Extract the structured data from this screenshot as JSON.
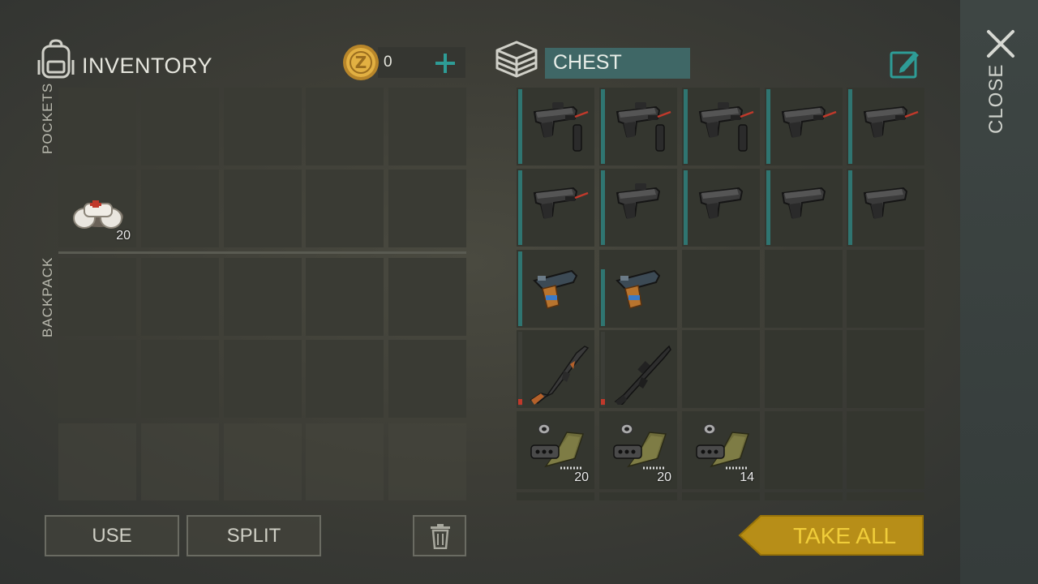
{
  "inventory": {
    "title": "INVENTORY",
    "coins": "0",
    "pockets_label": "POCKETS",
    "backpack_label": "BACKPACK",
    "items": [
      {
        "name": "bandage",
        "qty": "20"
      }
    ]
  },
  "chest": {
    "title": "CHEST",
    "items": [
      {
        "name": "pistol-suppressor-laser",
        "qty": ""
      },
      {
        "name": "pistol-suppressor-laser",
        "qty": ""
      },
      {
        "name": "pistol-suppressor-laser",
        "qty": ""
      },
      {
        "name": "pistol-laser",
        "qty": ""
      },
      {
        "name": "pistol-laser",
        "qty": ""
      },
      {
        "name": "pistol-laser",
        "qty": ""
      },
      {
        "name": "pistol-sight",
        "qty": ""
      },
      {
        "name": "pistol",
        "qty": ""
      },
      {
        "name": "pistol",
        "qty": ""
      },
      {
        "name": "pistol",
        "qty": ""
      },
      {
        "name": "flare-gun",
        "qty": ""
      },
      {
        "name": "flare-gun",
        "qty": ""
      },
      {
        "name": "ak-rifle",
        "qty": ""
      },
      {
        "name": "m4-rifle",
        "qty": ""
      },
      {
        "name": "ammo-bundle",
        "qty": "20"
      },
      {
        "name": "ammo-bundle",
        "qty": "20"
      },
      {
        "name": "ammo-bundle",
        "qty": "14"
      }
    ]
  },
  "buttons": {
    "use": "USE",
    "split": "SPLIT",
    "take_all": "TAKE ALL",
    "close": "CLOSE"
  },
  "colors": {
    "accent_teal": "#2f7571",
    "take_all_gold": "#f0cd3a",
    "durability_red": "#c0392b"
  }
}
